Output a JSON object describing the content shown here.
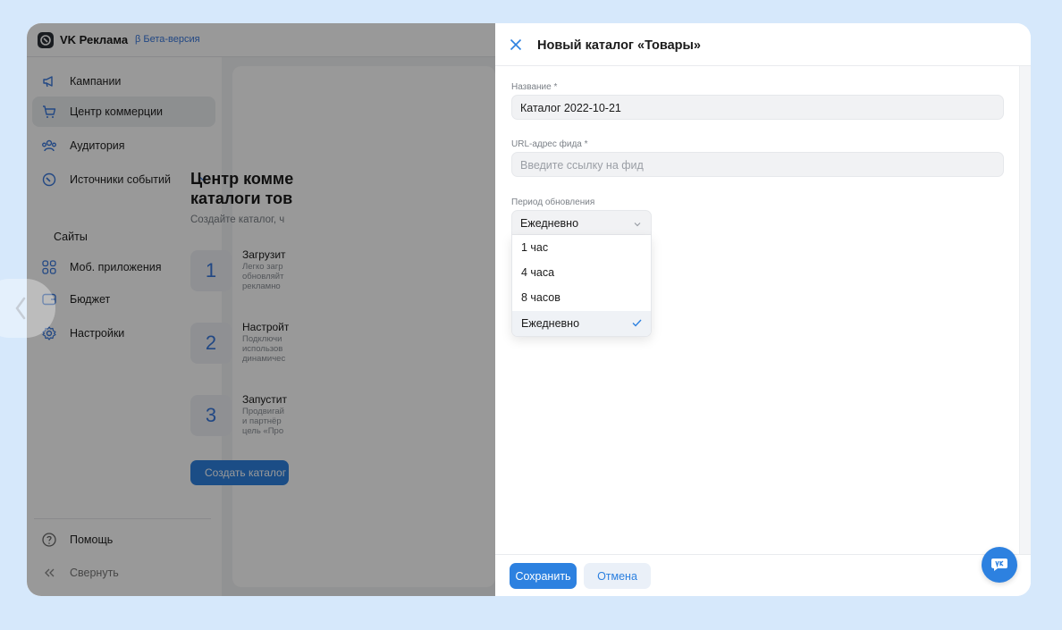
{
  "app": {
    "brand": "VK Реклама",
    "beta": "β Бета-версия"
  },
  "sidebar": {
    "items": [
      {
        "label": "Кампании",
        "icon": "megaphone-icon"
      },
      {
        "label": "Центр коммерции",
        "icon": "cart-icon"
      },
      {
        "label": "Аудитория",
        "icon": "audience-icon"
      },
      {
        "label": "Источники событий",
        "icon": "gauge-icon"
      },
      {
        "label": "Сайты"
      },
      {
        "label": "Моб. приложения",
        "icon": "apps-grid-icon"
      },
      {
        "label": "Бюджет",
        "icon": "wallet-icon"
      },
      {
        "label": "Настройки",
        "icon": "gear-icon"
      }
    ],
    "help": "Помощь",
    "collapse": "Свернуть"
  },
  "main": {
    "title_line1": "Центр комме",
    "title_line2": "каталоги тов",
    "subtitle": "Создайте каталог, ч",
    "steps": [
      {
        "num": "1",
        "title": "Загрузит",
        "desc": [
          "Легко загр",
          "обновляйт",
          "рекламно"
        ]
      },
      {
        "num": "2",
        "title": "Настройт",
        "desc": [
          "Подключи",
          "использов",
          "динамичес"
        ]
      },
      {
        "num": "3",
        "title": "Запустит",
        "desc": [
          "Продвигай",
          "и партнёр",
          "цель «Про"
        ]
      }
    ],
    "create_button": "Создать каталог"
  },
  "panel": {
    "title": "Новый каталог «Товары»",
    "name_label": "Название *",
    "name_value": "Каталог 2022-10-21",
    "url_label": "URL-адрес фида *",
    "url_placeholder": "Введите ссылку на фид",
    "period_label": "Период обновления",
    "period_selected": "Ежедневно",
    "period_options": [
      "1 час",
      "4 часа",
      "8 часов",
      "Ежедневно"
    ],
    "save": "Сохранить",
    "cancel": "Отмена"
  },
  "colors": {
    "accent": "#2d81e0",
    "beta": "#3a78dc",
    "background": "#d6e8fb"
  }
}
